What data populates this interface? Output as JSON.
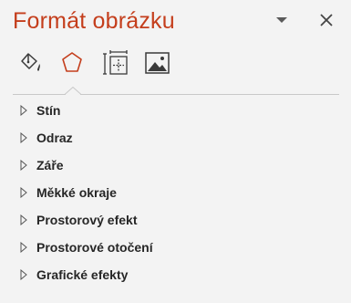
{
  "pane": {
    "title": "Formát obrázku",
    "accent_color": "#c43e1c"
  },
  "header": {
    "dropdown_icon": "chevron-down-icon",
    "close_icon": "close-icon"
  },
  "tabs": [
    {
      "icon": "paint-bucket-icon",
      "active": false
    },
    {
      "icon": "pentagon-effects-icon",
      "active": true
    },
    {
      "icon": "size-properties-icon",
      "active": false
    },
    {
      "icon": "picture-icon",
      "active": false
    }
  ],
  "sections": [
    {
      "label": "Stín"
    },
    {
      "label": "Odraz"
    },
    {
      "label": "Záře"
    },
    {
      "label": "Měkké okraje"
    },
    {
      "label": "Prostorový efekt"
    },
    {
      "label": "Prostorové otočení"
    },
    {
      "label": "Grafické efekty"
    }
  ]
}
